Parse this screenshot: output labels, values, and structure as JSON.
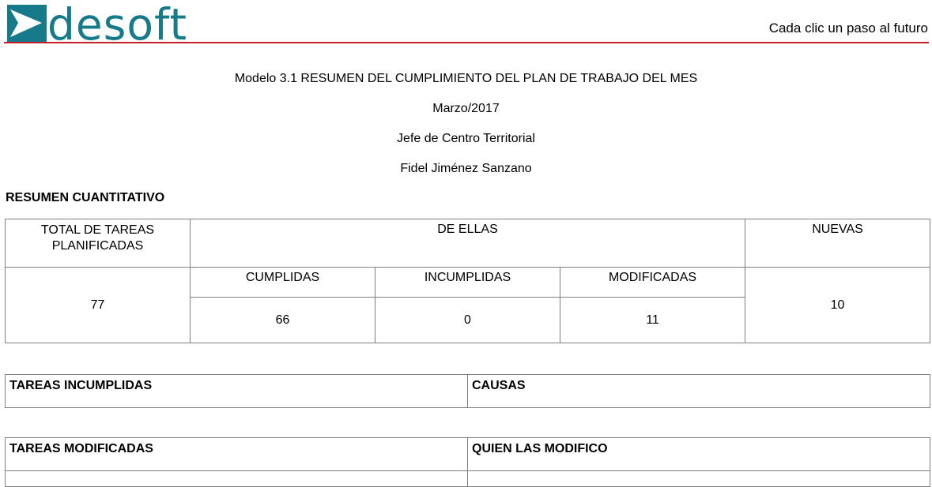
{
  "header": {
    "logo_text": "desoft",
    "tagline": "Cada clic un paso al futuro",
    "brand_color": "#167a8a",
    "rule_color": "#c8202b"
  },
  "document": {
    "title": "Modelo 3.1 RESUMEN DEL CUMPLIMIENTO DEL PLAN DE TRABAJO DEL MES",
    "period": "Marzo/2017",
    "position": "Jefe de Centro Territorial",
    "person": "Fidel Jiménez Sanzano"
  },
  "summary": {
    "section_title": "RESUMEN CUANTITATIVO",
    "headers": {
      "total": "TOTAL DE TAREAS PLANIFICADAS",
      "de_ellas": "DE ELLAS",
      "nuevas": "NUEVAS",
      "cumplidas": "CUMPLIDAS",
      "incumplidas": "INCUMPLIDAS",
      "modificadas": "MODIFICADAS"
    },
    "values": {
      "total": "77",
      "cumplidas": "66",
      "incumplidas": "0",
      "modificadas": "11",
      "nuevas": "10"
    }
  },
  "incumplidas_table": {
    "col1": "TAREAS INCUMPLIDAS",
    "col2": "CAUSAS"
  },
  "modificadas_table": {
    "col1": "TAREAS MODIFICADAS",
    "col2": "QUIEN LAS MODIFICO"
  }
}
